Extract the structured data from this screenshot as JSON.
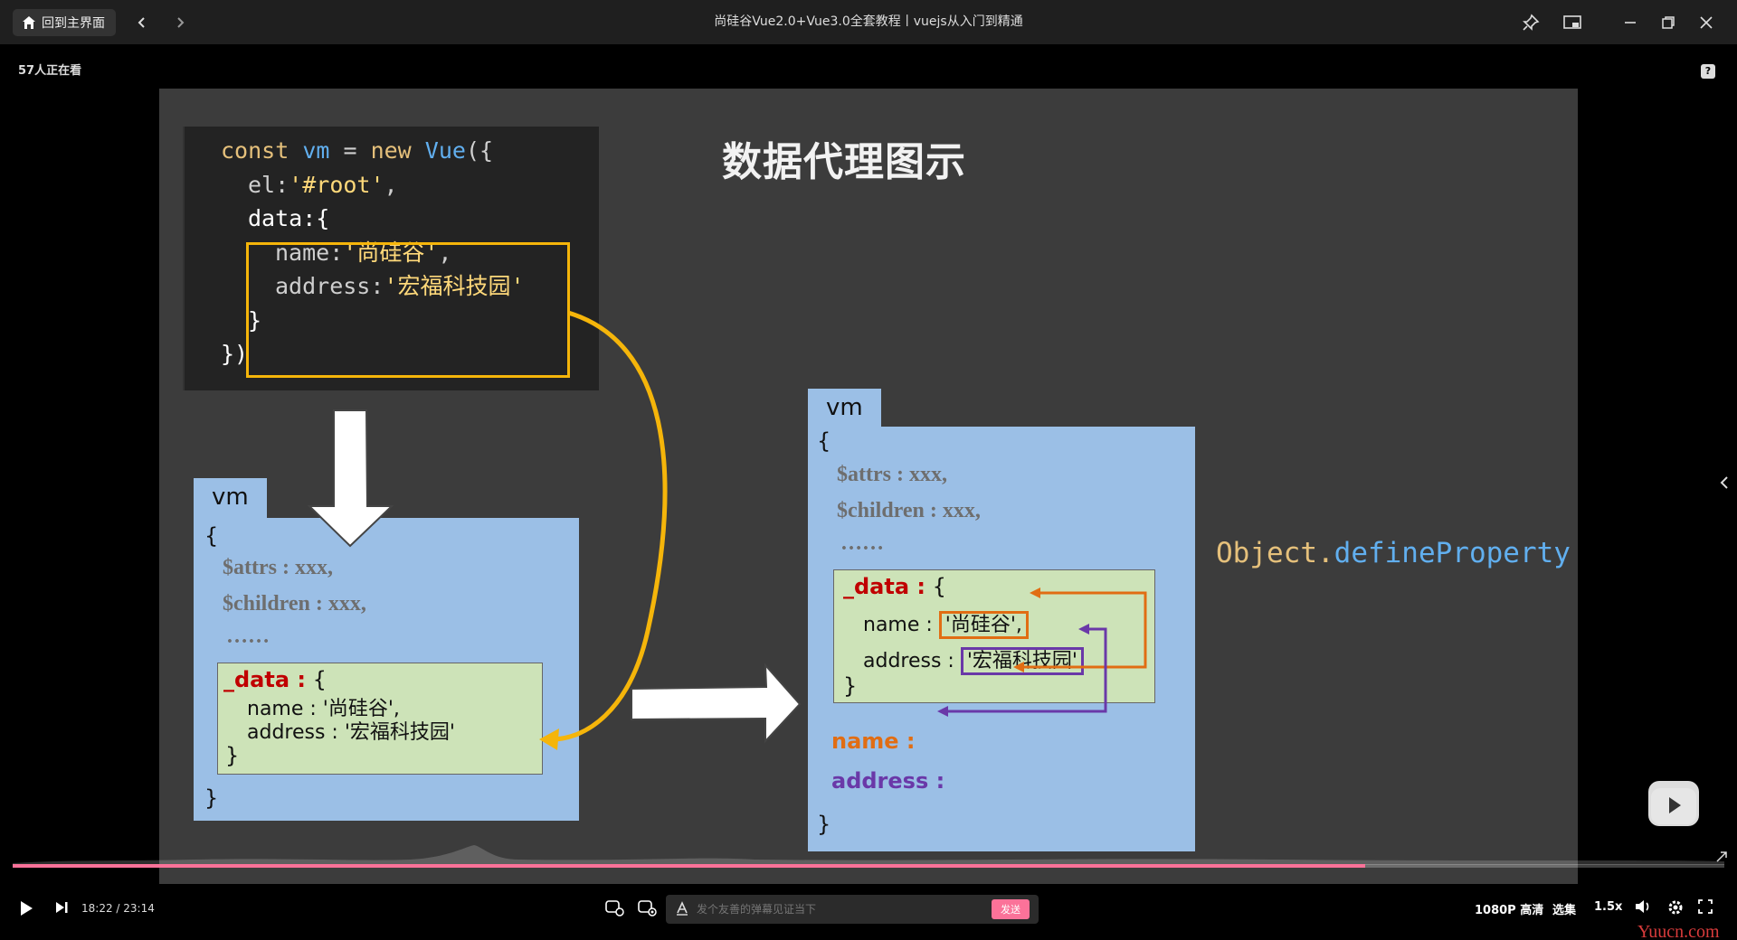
{
  "titlebar": {
    "home_label": "回到主界面",
    "title": "尚硅谷Vue2.0+Vue3.0全套教程丨vuejs从入门到精通"
  },
  "player": {
    "viewers": "57人正在看"
  },
  "slide": {
    "title": "数据代理图示",
    "code": {
      "line1_kw1": "const ",
      "line1_id1": "vm ",
      "line1_op": "= ",
      "line1_kw2": "new ",
      "line1_id2": "Vue",
      "line1_tail": "({",
      "line2_key": "el",
      "line2_val": "'#root'",
      "line3": "data:{",
      "line4_key": "name",
      "line4_val": "'尚硅谷'",
      "line5_key": "address",
      "line5_val": "'宏福科技园'",
      "line6": "}",
      "line7": "})"
    },
    "left_vm": {
      "tab": "vm",
      "open": "{",
      "attrs": "$attrs : xxx,",
      "children": "$children : xxx,",
      "dots": "……",
      "data_key": "_data :",
      "data_open": "{",
      "name_line": "name : '尚硅谷',",
      "address_line": "address : '宏福科技园'",
      "data_close": "}",
      "close": "}"
    },
    "right_vm": {
      "tab": "vm",
      "open": "{",
      "attrs": "$attrs : xxx,",
      "children": "$children : xxx,",
      "dots": "……",
      "data_key": "_data :",
      "data_open": "{",
      "name_key": "name :",
      "name_val": "'尚硅谷',",
      "address_key": "address :",
      "address_val": "'宏福科技园'",
      "data_close": "}",
      "proxy_name": "name :",
      "proxy_address": "address :",
      "close": "}"
    },
    "define_property": {
      "obj": "Object",
      "dot": ".",
      "method": "defineProperty"
    }
  },
  "progress": {
    "played_fraction": 0.79
  },
  "controls": {
    "time": "18:22 / 23:14",
    "danmaku_placeholder": "发个友善的弹幕见证当下",
    "send_label": "发送",
    "quality": "1080P 高清",
    "episodes": "选集",
    "speed": "1.5x"
  },
  "watermark": "Yuucn.com",
  "colors": {
    "accent": "#fb7299",
    "highlight_yellow": "#f5b50a",
    "proxy_orange": "#e16d13",
    "proxy_purple": "#6a38a8",
    "vm_blue": "#9bbfe6",
    "data_green": "#cde3b8"
  }
}
